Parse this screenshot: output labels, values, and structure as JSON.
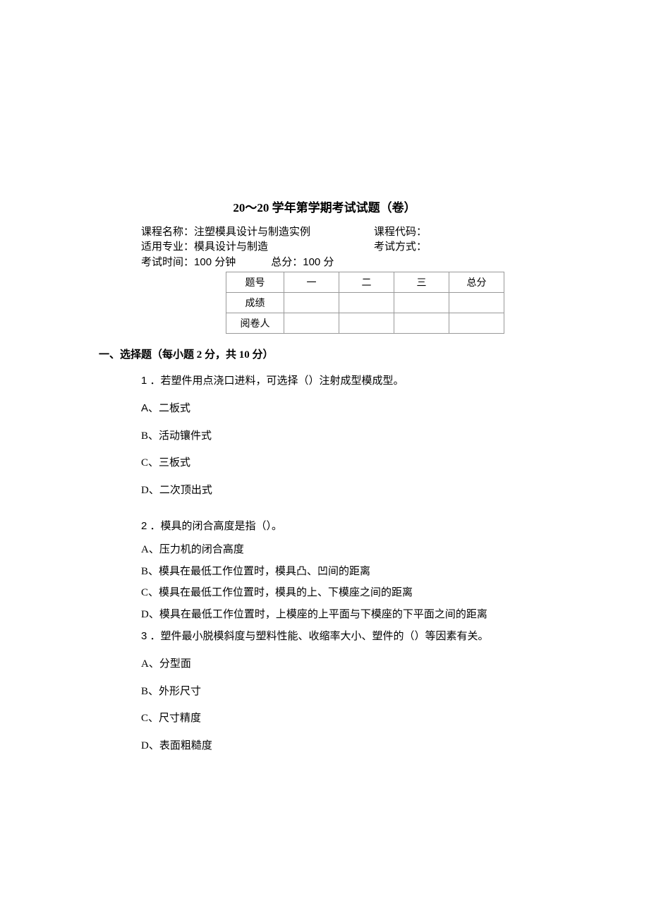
{
  "title": "20～20 学年第学期考试试题（卷）",
  "meta": {
    "course_label": "课程名称：",
    "course_name": "注塑模具设计与制造实例",
    "code_label": "课程代码：",
    "major_label": "适用专业：",
    "major_name": "模具设计与制造",
    "method_label": "考试方式：",
    "time_label": "考试时间：",
    "time_value": "100 分钟",
    "total_label": "总分：",
    "total_value": "100 分"
  },
  "table": {
    "headers": [
      "题号",
      "一",
      "二",
      "三",
      "总分"
    ],
    "rows": [
      "成绩",
      "阅卷人"
    ]
  },
  "section1": {
    "heading": "一、选择题（每小题 2 分，共 10 分）",
    "q1": {
      "num": "1 ．",
      "text": "若塑件用点浇口进料，可选择（）注射成型模成型。",
      "a": "A、二板式",
      "b": "B、活动镶件式",
      "c": "C、三板式",
      "d": "D、二次顶出式"
    },
    "q2": {
      "num": "2 ．",
      "text": "模具的闭合高度是指（）。",
      "a": "A、压力机的闭合高度",
      "b": "B、模具在最低工作位置时，模具凸、凹间的距离",
      "c": "C、模具在最低工作位置时，模具的上、下模座之间的距离",
      "d": "D、模具在最低工作位置时，上模座的上平面与下模座的下平面之间的距离"
    },
    "q3": {
      "num": "3 ．",
      "text": "塑件最小脱模斜度与塑料性能、收缩率大小、塑件的（）等因素有关。",
      "a": "A、分型面",
      "b": "B、外形尺寸",
      "c": "C、尺寸精度",
      "d": "D、表面粗糙度"
    }
  }
}
